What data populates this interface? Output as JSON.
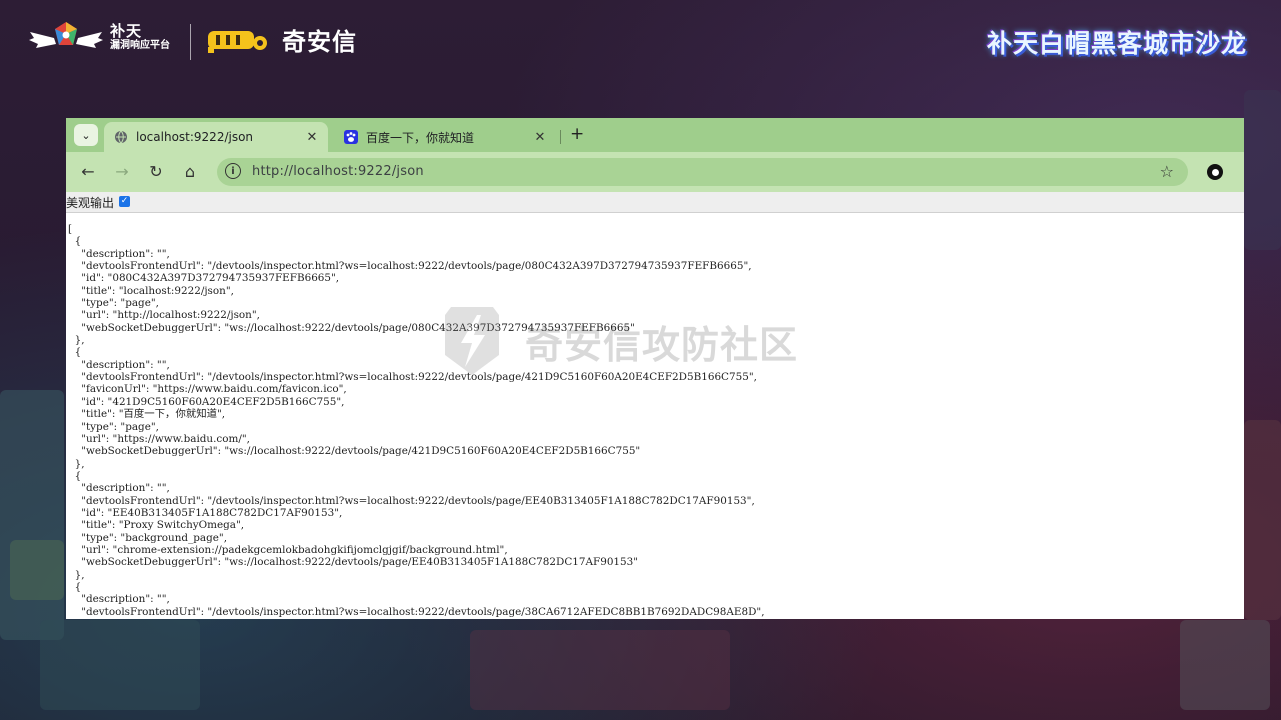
{
  "header": {
    "butian_name": "补天",
    "butian_sub": "漏洞响应平台",
    "qax_name": "奇安信",
    "salon_title": "补天白帽黑客城市沙龙"
  },
  "browser": {
    "tabs": [
      {
        "title": "localhost:9222/json",
        "icon": "globe-icon"
      },
      {
        "title": "百度一下，你就知道",
        "icon": "baidu-paw-icon"
      }
    ],
    "new_tab": "+",
    "close_glyph": "✕",
    "url": "http://localhost:9222/json",
    "pretty_print_label": "美观输出",
    "pretty_print_checked": true
  },
  "json_text": "[\n  {\n    \"description\": \"\",\n    \"devtoolsFrontendUrl\": \"/devtools/inspector.html?ws=localhost:9222/devtools/page/080C432A397D372794735937FEFB6665\",\n    \"id\": \"080C432A397D372794735937FEFB6665\",\n    \"title\": \"localhost:9222/json\",\n    \"type\": \"page\",\n    \"url\": \"http://localhost:9222/json\",\n    \"webSocketDebuggerUrl\": \"ws://localhost:9222/devtools/page/080C432A397D372794735937FEFB6665\"\n  },\n  {\n    \"description\": \"\",\n    \"devtoolsFrontendUrl\": \"/devtools/inspector.html?ws=localhost:9222/devtools/page/421D9C5160F60A20E4CEF2D5B166C755\",\n    \"faviconUrl\": \"https://www.baidu.com/favicon.ico\",\n    \"id\": \"421D9C5160F60A20E4CEF2D5B166C755\",\n    \"title\": \"百度一下，你就知道\",\n    \"type\": \"page\",\n    \"url\": \"https://www.baidu.com/\",\n    \"webSocketDebuggerUrl\": \"ws://localhost:9222/devtools/page/421D9C5160F60A20E4CEF2D5B166C755\"\n  },\n  {\n    \"description\": \"\",\n    \"devtoolsFrontendUrl\": \"/devtools/inspector.html?ws=localhost:9222/devtools/page/EE40B313405F1A188C782DC17AF90153\",\n    \"id\": \"EE40B313405F1A188C782DC17AF90153\",\n    \"title\": \"Proxy SwitchyOmega\",\n    \"type\": \"background_page\",\n    \"url\": \"chrome-extension://padekgcemlokbadohgkifijomclgjgif/background.html\",\n    \"webSocketDebuggerUrl\": \"ws://localhost:9222/devtools/page/EE40B313405F1A188C782DC17AF90153\"\n  },\n  {\n    \"description\": \"\",\n    \"devtoolsFrontendUrl\": \"/devtools/inspector.html?ws=localhost:9222/devtools/page/38CA6712AFEDC8BB1B7692DADC98AE8D\",",
  "watermark_text": "奇安信攻防社区",
  "colors": {
    "tabstrip": "#9fce8c",
    "toolbar": "#c4e3b2",
    "omnibox": "#a9d395",
    "background": "#2a1c33"
  }
}
